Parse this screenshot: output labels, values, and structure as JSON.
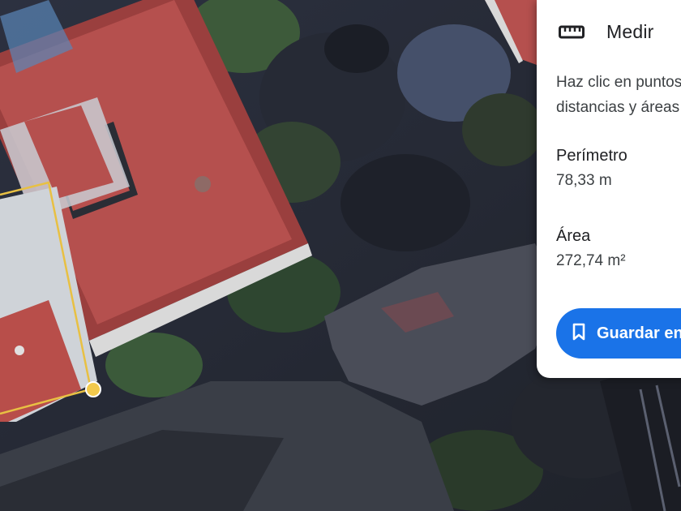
{
  "panel": {
    "title": "Medir",
    "instructions": "Haz clic en puntos para medir distancias y áreas",
    "perimeter_label": "Perímetro",
    "perimeter_value": "78,33 m",
    "area_label": "Área",
    "area_value": "272,74 m²",
    "save_label": "Guardar en proyecto"
  },
  "icons": {
    "measure": "ruler-icon",
    "save": "bookmark-icon"
  },
  "colors": {
    "accent": "#1a73e8",
    "measure_line": "#e8c043",
    "roof": "#b5504e"
  }
}
